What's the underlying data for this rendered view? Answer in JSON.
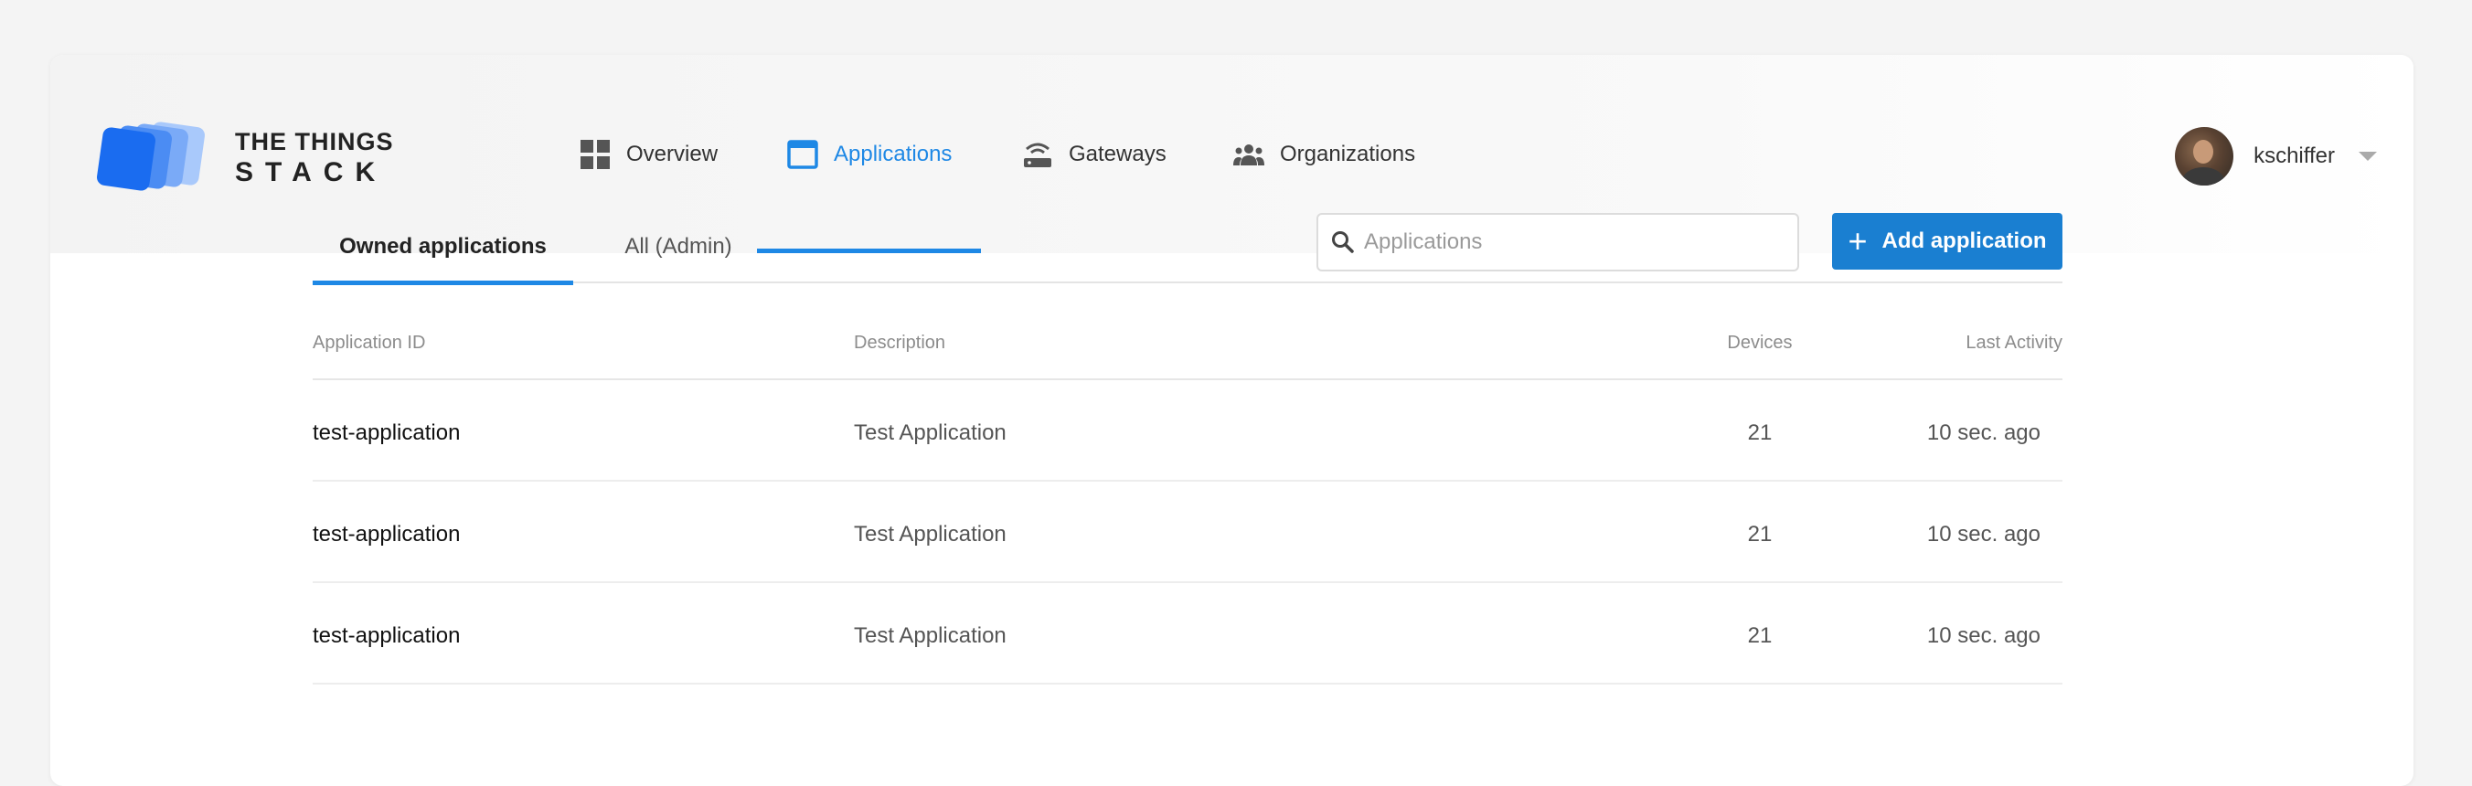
{
  "brand": {
    "line1": "THE THINGS",
    "line2": "STACK"
  },
  "nav": {
    "items": [
      {
        "label": "Overview",
        "icon": "grid-icon"
      },
      {
        "label": "Applications",
        "icon": "window-icon",
        "active": true
      },
      {
        "label": "Gateways",
        "icon": "gateway-icon"
      },
      {
        "label": "Organizations",
        "icon": "group-icon"
      }
    ]
  },
  "user": {
    "name": "kschiffer"
  },
  "tabs": [
    {
      "label": "Owned applications",
      "active": true
    },
    {
      "label": "All (Admin)"
    }
  ],
  "search": {
    "placeholder": "Applications",
    "value": ""
  },
  "add_button": {
    "label": "Add application"
  },
  "table": {
    "columns": [
      "Application ID",
      "Description",
      "Devices",
      "Last Activity"
    ],
    "rows": [
      {
        "id": "test-application",
        "description": "Test Application",
        "devices": "21",
        "last_activity": "10 sec. ago"
      },
      {
        "id": "test-application",
        "description": "Test Application",
        "devices": "21",
        "last_activity": "10 sec. ago"
      },
      {
        "id": "test-application",
        "description": "Test Application",
        "devices": "21",
        "last_activity": "10 sec. ago"
      }
    ]
  },
  "colors": {
    "accent": "#1e88e5",
    "button": "#1a7fd1"
  }
}
